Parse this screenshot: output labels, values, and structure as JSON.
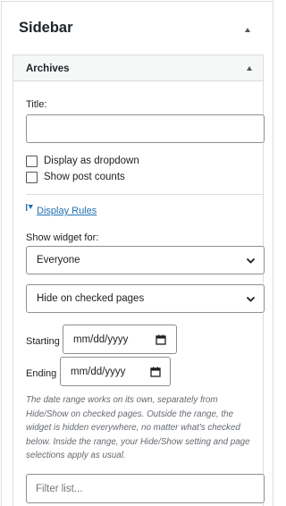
{
  "sidebar": {
    "title": "Sidebar"
  },
  "widget": {
    "title": "Archives",
    "title_field": {
      "label": "Title:",
      "value": ""
    },
    "options": [
      {
        "label": "Display as dropdown",
        "checked": false
      },
      {
        "label": "Show post counts",
        "checked": false
      }
    ],
    "display_rules": {
      "link_label": "Display Rules",
      "show_for_label": "Show widget for:",
      "show_for_value": "Everyone",
      "visibility_value": "Hide on checked pages",
      "starting_label": "Starting",
      "starting_value": "mm/dd/yyyy",
      "ending_label": "Ending",
      "ending_value": "mm/dd/yyyy",
      "help_text": "The date range works on its own, separately from Hide/Show on checked pages. Outside the range, the widget is hidden everywhere, no matter what's checked below. Inside the range, your Hide/Show setting and page selections apply as usual.",
      "filter_placeholder": "Filter list..."
    }
  },
  "colors": {
    "link": "#2271b1",
    "border": "#8c8f94",
    "header_bg": "#f6f7f7"
  }
}
